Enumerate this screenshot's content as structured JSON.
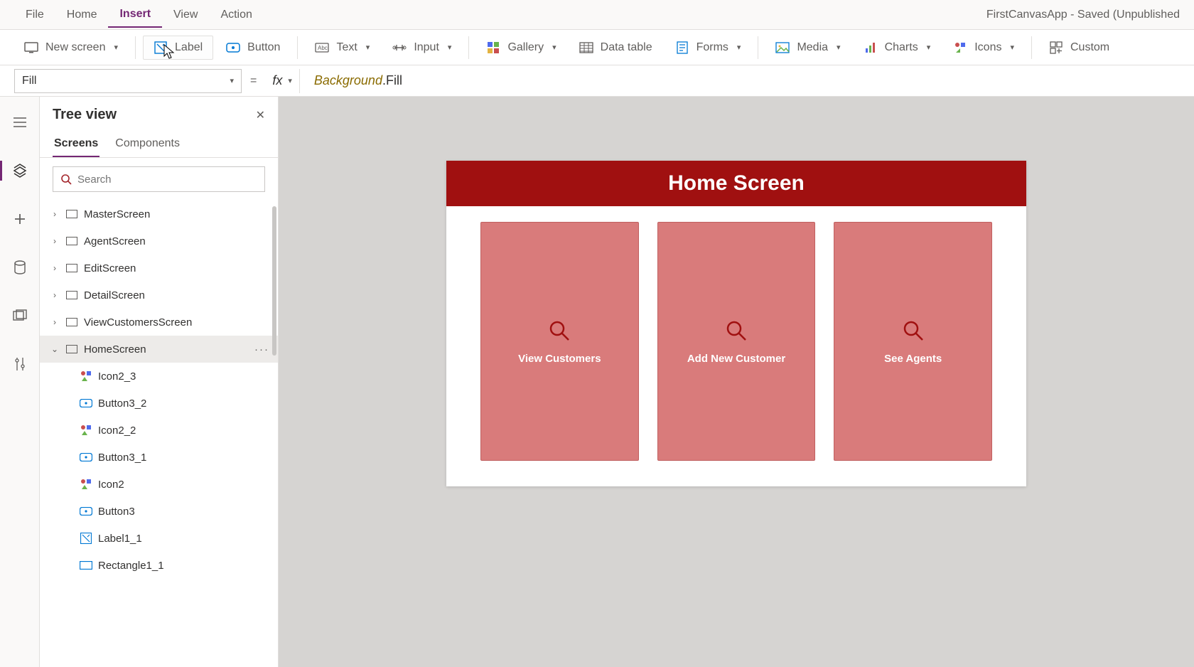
{
  "app_title": "FirstCanvasApp - Saved (Unpublished",
  "menu": {
    "file": "File",
    "home": "Home",
    "insert": "Insert",
    "view": "View",
    "action": "Action",
    "active": "insert"
  },
  "ribbon": {
    "new_screen": "New screen",
    "label": "Label",
    "button": "Button",
    "text": "Text",
    "input": "Input",
    "gallery": "Gallery",
    "data_table": "Data table",
    "forms": "Forms",
    "media": "Media",
    "charts": "Charts",
    "icons": "Icons",
    "custom": "Custom"
  },
  "formula": {
    "property": "Fill",
    "equals": "=",
    "fx": "fx",
    "object": "Background",
    "dot": ".",
    "prop": "Fill"
  },
  "tree": {
    "title": "Tree view",
    "tab_screens": "Screens",
    "tab_components": "Components",
    "search_placeholder": "Search",
    "items": [
      {
        "name": "MasterScreen",
        "type": "screen",
        "expanded": false
      },
      {
        "name": "AgentScreen",
        "type": "screen",
        "expanded": false
      },
      {
        "name": "EditScreen",
        "type": "screen",
        "expanded": false
      },
      {
        "name": "DetailScreen",
        "type": "screen",
        "expanded": false
      },
      {
        "name": "ViewCustomersScreen",
        "type": "screen",
        "expanded": false
      },
      {
        "name": "HomeScreen",
        "type": "screen",
        "expanded": true,
        "selected": true
      }
    ],
    "children": [
      {
        "name": "Icon2_3",
        "type": "icon"
      },
      {
        "name": "Button3_2",
        "type": "button"
      },
      {
        "name": "Icon2_2",
        "type": "icon"
      },
      {
        "name": "Button3_1",
        "type": "button"
      },
      {
        "name": "Icon2",
        "type": "icon"
      },
      {
        "name": "Button3",
        "type": "button"
      },
      {
        "name": "Label1_1",
        "type": "label"
      },
      {
        "name": "Rectangle1_1",
        "type": "rect"
      }
    ],
    "more": "···"
  },
  "canvas": {
    "header": "Home Screen",
    "tiles": [
      {
        "label": "View Customers"
      },
      {
        "label": "Add New Customer"
      },
      {
        "label": "See Agents"
      }
    ]
  },
  "colors": {
    "accent": "#742774",
    "brand_header": "#a01010",
    "tile_fill": "#d97b7b"
  }
}
